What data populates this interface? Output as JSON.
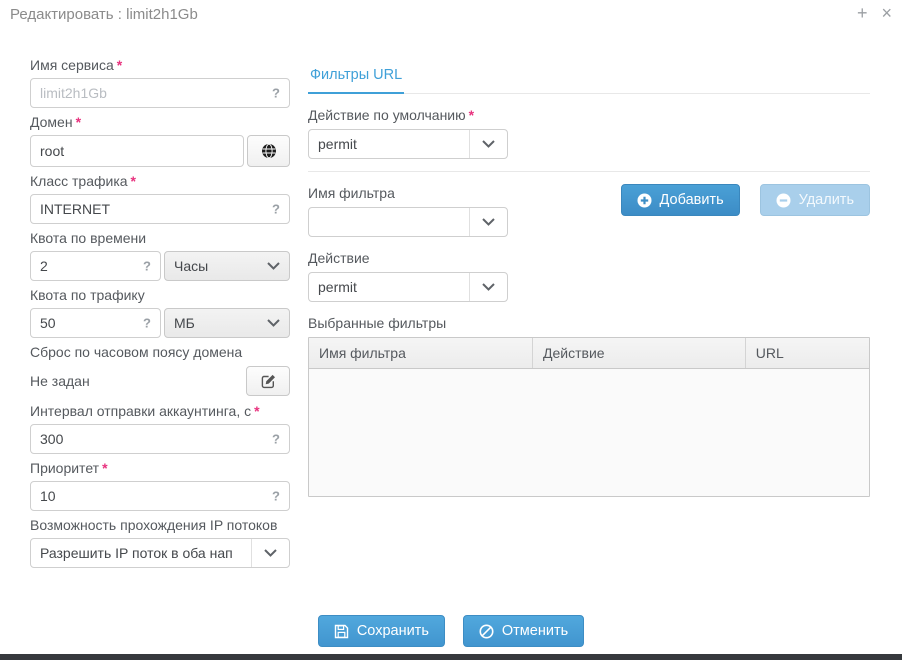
{
  "window": {
    "title": "Редактировать : limit2h1Gb",
    "expand_icon": "+",
    "close_icon": "×"
  },
  "markers": {
    "required": "*",
    "help": "?"
  },
  "service_form": {
    "service_name": {
      "label": "Имя сервиса",
      "value": "limit2h1Gb"
    },
    "domain": {
      "label": "Домен",
      "value": "root"
    },
    "traffic_class": {
      "label": "Класс трафика",
      "value": "INTERNET"
    },
    "time_quota": {
      "label": "Квота по времени",
      "value": "2",
      "unit": "Часы"
    },
    "traffic_quota": {
      "label": "Квота по трафику",
      "value": "50",
      "unit": "МБ"
    },
    "timezone_reset": {
      "label": "Сброс по часовом поясу домена",
      "value": "Не задан"
    },
    "accounting_interval": {
      "label": "Интервал отправки аккаунтинга, с",
      "value": "300"
    },
    "priority": {
      "label": "Приоритет",
      "value": "10"
    },
    "ip_flow": {
      "label": "Возможность прохождения IP потоков",
      "value": "Разрешить IP поток в оба нап"
    }
  },
  "filters_panel": {
    "tab": "Фильтры URL",
    "default_action": {
      "label": "Действие по умолчанию",
      "value": "permit"
    },
    "filter_name": {
      "label": "Имя фильтра",
      "value": ""
    },
    "action": {
      "label": "Действие",
      "value": "permit"
    },
    "buttons": {
      "add": "Добавить",
      "remove": "Удалить"
    },
    "selected_filters_label": "Выбранные фильтры",
    "table": {
      "columns": [
        "Имя фильтра",
        "Действие",
        "URL"
      ],
      "rows": []
    }
  },
  "footer": {
    "save": "Сохранить",
    "cancel": "Отменить"
  },
  "colors": {
    "accent_blue": "#3f97d3",
    "tab_blue": "#3fa0d8",
    "required_pink": "#e8327e",
    "disabled_button_blue": "#a9cfeb",
    "bottom_bar": "#36393d"
  }
}
